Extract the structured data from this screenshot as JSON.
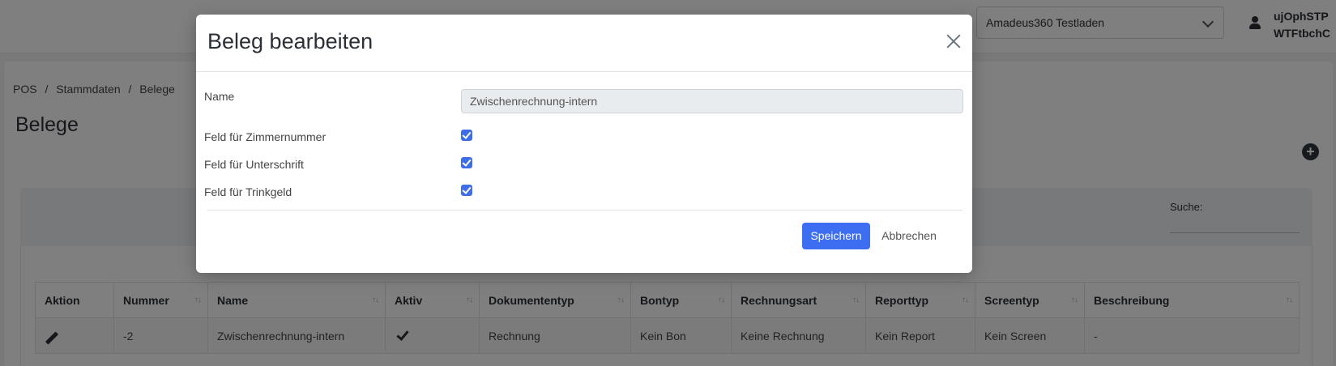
{
  "header": {
    "store_select": "Amadeus360 Testladen",
    "user_line1": "ujOphSTP",
    "user_line2": "WTFtbchC"
  },
  "breadcrumb": [
    "POS",
    "/",
    "Stammdaten",
    "/",
    "Belege"
  ],
  "page_title": "Belege",
  "search_label": "Suche:",
  "table": {
    "columns": [
      "Aktion",
      "Nummer",
      "Name",
      "Aktiv",
      "Dokumententyp",
      "Bontyp",
      "Rechnungsart",
      "Reporttyp",
      "Screentyp",
      "Beschreibung"
    ],
    "rows": [
      {
        "nummer": "-2",
        "name": "Zwischenrechnung-intern",
        "dokumententyp": "Rechnung",
        "bontyp": "Kein Bon",
        "rechnungsart": "Keine Rechnung",
        "reporttyp": "Kein Report",
        "screentyp": "Kein Screen",
        "beschreibung": "-"
      }
    ]
  },
  "modal": {
    "title": "Beleg bearbeiten",
    "name_label": "Name",
    "name_value": "Zwischenrechnung-intern",
    "field_room": "Feld für Zimmernummer",
    "field_signature": "Feld für Unterschrift",
    "field_tip": "Feld für Trinkgeld",
    "save_label": "Speichern",
    "cancel_label": "Abbrechen"
  },
  "colors": {
    "primary": "#3d6ef2",
    "checkbox": "#3d6ee8"
  }
}
